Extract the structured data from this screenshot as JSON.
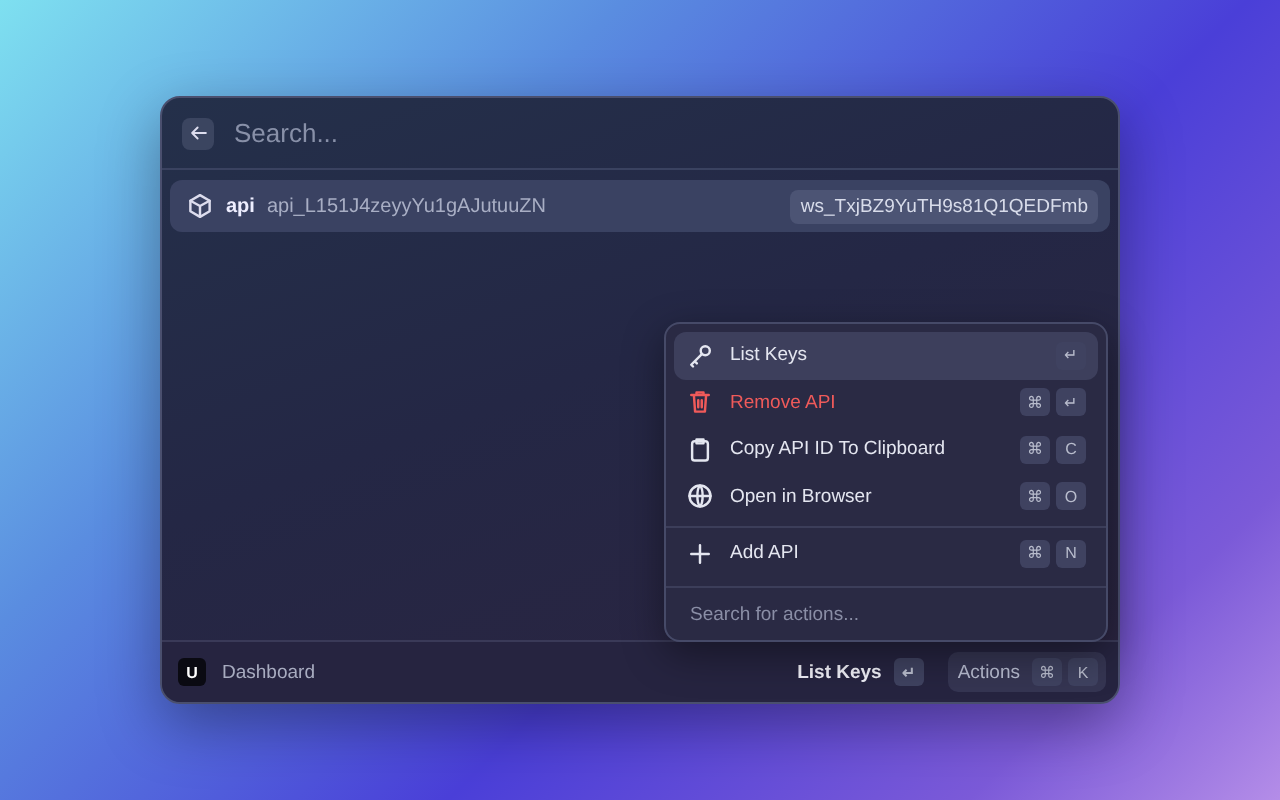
{
  "search": {
    "placeholder": "Search..."
  },
  "items": [
    {
      "title": "api",
      "subtitle": "api_L151J4zeyyYu1gAJutuuZN",
      "accessory": "ws_TxjBZ9YuTH9s81Q1QEDFmb",
      "selected": true
    }
  ],
  "actions": [
    {
      "label": "List Keys",
      "kind": "normal",
      "selected": true,
      "keys": [
        "↵"
      ]
    },
    {
      "label": "Remove API",
      "kind": "destructive",
      "selected": false,
      "keys": [
        "⌘",
        "↵"
      ]
    },
    {
      "label": "Copy API ID To Clipboard",
      "kind": "normal",
      "selected": false,
      "keys": [
        "⌘",
        "C"
      ]
    },
    {
      "label": "Open in Browser",
      "kind": "normal",
      "selected": false,
      "keys": [
        "⌘",
        "O"
      ]
    },
    {
      "label": "Add API",
      "kind": "normal",
      "selected": false,
      "keys": [
        "⌘",
        "N"
      ]
    }
  ],
  "action_search": {
    "placeholder": "Search for actions..."
  },
  "footer": {
    "logo": "U",
    "title": "Dashboard",
    "primary_action": {
      "label": "List Keys",
      "keys": [
        "↵"
      ]
    },
    "actions_button": {
      "label": "Actions",
      "keys": [
        "⌘",
        "K"
      ]
    }
  }
}
